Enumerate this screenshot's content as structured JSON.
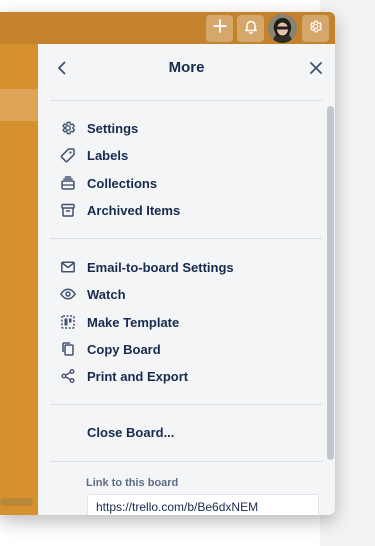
{
  "header": {
    "title": "More",
    "back_icon": "chevron-left-icon",
    "close_icon": "close-icon"
  },
  "topbar": {
    "icons": [
      "plus-icon",
      "bell-icon",
      "avatar",
      "gear-icon"
    ]
  },
  "menu_sections": [
    [
      {
        "label": "Settings",
        "icon": "gear-icon"
      },
      {
        "label": "Labels",
        "icon": "tag-icon"
      },
      {
        "label": "Collections",
        "icon": "collections-icon"
      },
      {
        "label": "Archived Items",
        "icon": "archive-icon"
      }
    ],
    [
      {
        "label": "Email-to-board Settings",
        "icon": "envelope-icon"
      },
      {
        "label": "Watch",
        "icon": "eye-icon"
      },
      {
        "label": "Make Template",
        "icon": "template-icon"
      },
      {
        "label": "Copy Board",
        "icon": "copy-icon"
      },
      {
        "label": "Print and Export",
        "icon": "share-icon"
      }
    ]
  ],
  "close_board_label": "Close Board...",
  "link": {
    "label": "Link to this board",
    "url": "https://trello.com/b/Be6dxNEM"
  },
  "colors": {
    "board_background": "#d89a3c",
    "topbar": "#c4822c",
    "panel": "#f4f5f7",
    "text": "#172b4d",
    "muted_text": "#5e6c84"
  }
}
